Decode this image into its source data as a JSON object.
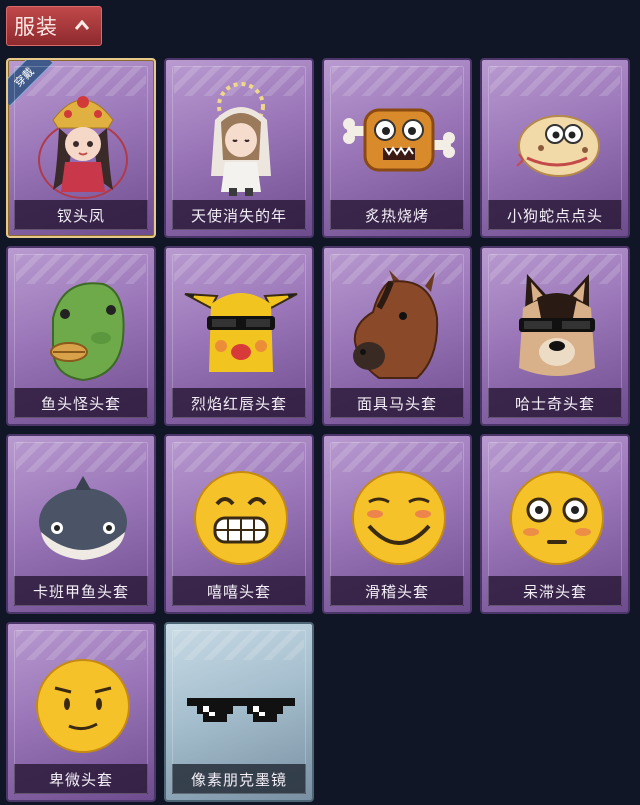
{
  "section": {
    "title": "服装",
    "expanded": true,
    "toggle_icon": "chevron-up-icon"
  },
  "badge_text": "穿戴",
  "colors": {
    "background": "#101626",
    "tab": "#a83a3d",
    "card_purple": "#9a76b8",
    "card_blue": "#a6bfce",
    "selected_border": "#e7c98a"
  },
  "items": [
    {
      "name": "钗头凤",
      "icon": "phoenix-crown-doll-icon",
      "equipped": true
    },
    {
      "name": "天使消失的年",
      "icon": "angel-girl-icon"
    },
    {
      "name": "炙热烧烤",
      "icon": "bbq-meat-face-icon"
    },
    {
      "name": "小狗蛇点点头",
      "icon": "cartoon-snake-head-icon"
    },
    {
      "name": "鱼头怪头套",
      "icon": "fish-head-mask-icon"
    },
    {
      "name": "烈焰红唇头套",
      "icon": "yellow-pikachu-mask-icon"
    },
    {
      "name": "面具马头套",
      "icon": "horse-mask-icon"
    },
    {
      "name": "哈士奇头套",
      "icon": "husky-mask-icon"
    },
    {
      "name": "卡班甲鱼头套",
      "icon": "gray-whale-head-icon"
    },
    {
      "name": "嘻嘻头套",
      "icon": "grin-emoji-head-icon"
    },
    {
      "name": "滑稽头套",
      "icon": "funny-emoji-head-icon"
    },
    {
      "name": "呆滞头套",
      "icon": "dazed-emoji-head-icon"
    },
    {
      "name": "卑微头套",
      "icon": "humble-emoji-head-icon"
    },
    {
      "name": "像素朋克墨镜",
      "icon": "pixel-sunglasses-icon",
      "rarity": "blue"
    }
  ]
}
